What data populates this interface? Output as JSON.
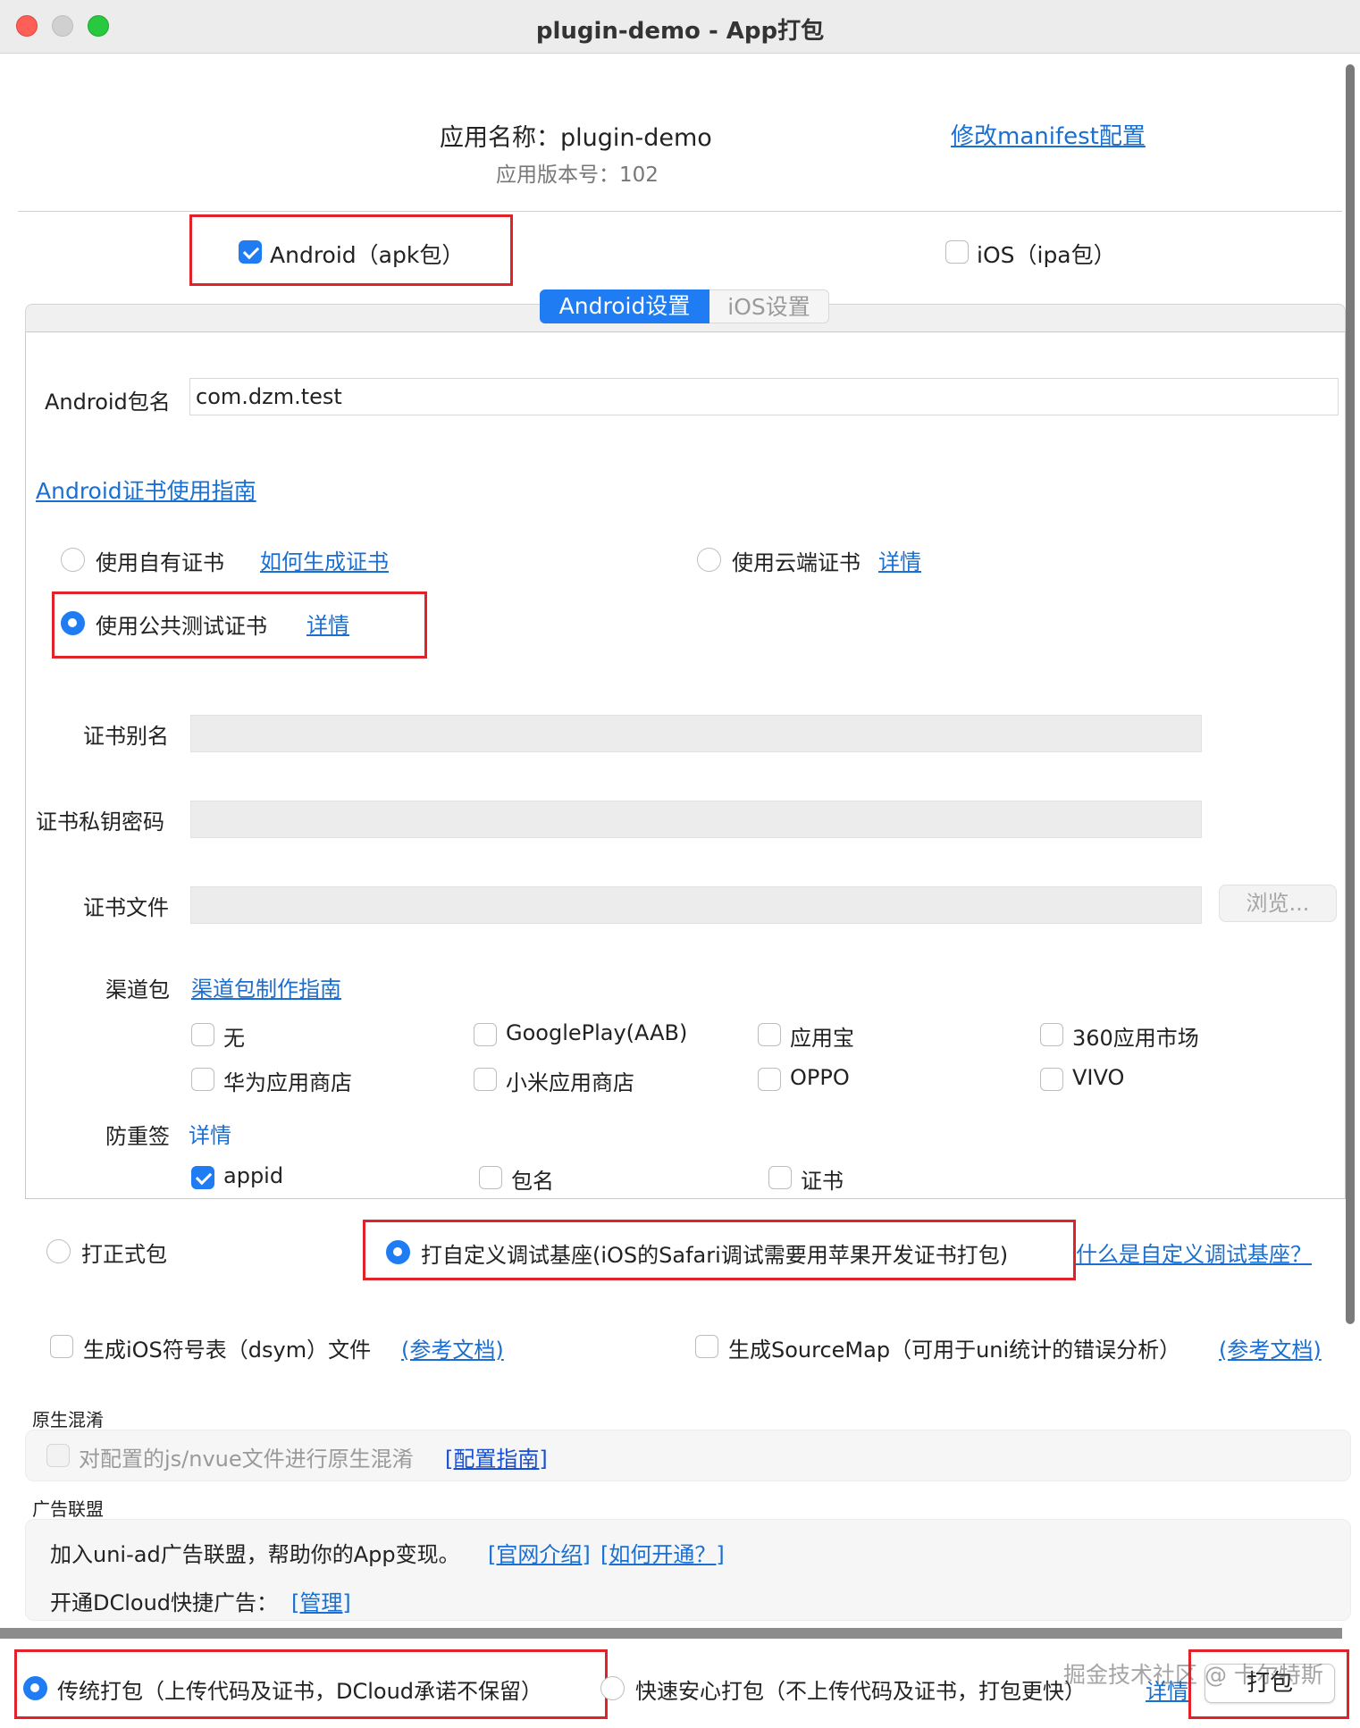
{
  "window": {
    "title": "plugin-demo - App打包"
  },
  "header": {
    "app_name": "应用名称：plugin-demo",
    "app_version": "应用版本号：102",
    "edit_manifest_link": "修改manifest配置"
  },
  "platforms": {
    "android_label": "Android（apk包）",
    "android_checked": true,
    "ios_label": "iOS（ipa包）",
    "ios_checked": false
  },
  "tabs": [
    {
      "label": "Android设置",
      "active": true
    },
    {
      "label": "iOS设置",
      "active": false
    }
  ],
  "android": {
    "package_name_label": "Android包名",
    "package_name_value": "com.dzm.test",
    "cert_guide_link": "Android证书使用指南",
    "cert_options": {
      "own_cert_label": "使用自有证书",
      "own_cert_link": "如何生成证书",
      "cloud_cert_label": "使用云端证书",
      "cloud_cert_link": "详情",
      "public_cert_label": "使用公共测试证书",
      "public_cert_link": "详情",
      "selected": "public"
    },
    "cert_alias_label": "证书别名",
    "cert_alias_value": "",
    "cert_password_label": "证书私钥密码",
    "cert_password_value": "",
    "cert_file_label": "证书文件",
    "cert_file_value": "",
    "browse_button": "浏览...",
    "channel_label": "渠道包",
    "channel_link": "渠道包制作指南",
    "channels": [
      {
        "label": "无",
        "checked": false
      },
      {
        "label": "GooglePlay(AAB)",
        "checked": false
      },
      {
        "label": "应用宝",
        "checked": false
      },
      {
        "label": "360应用市场",
        "checked": false
      },
      {
        "label": "华为应用商店",
        "checked": false
      },
      {
        "label": "小米应用商店",
        "checked": false
      },
      {
        "label": "OPPO",
        "checked": false
      },
      {
        "label": "VIVO",
        "checked": false
      }
    ],
    "anti_resign_label": "防重签",
    "anti_resign_link": "详情",
    "anti_resign_options": [
      {
        "label": "appid",
        "checked": true
      },
      {
        "label": "包名",
        "checked": false
      },
      {
        "label": "证书",
        "checked": false
      }
    ]
  },
  "build_type": {
    "release_label": "打正式包",
    "custom_base_label": "打自定义调试基座(iOS的Safari调试需要用苹果开发证书打包)",
    "custom_base_help_link": "什么是自定义调试基座？",
    "selected": "custom_base"
  },
  "extras": {
    "dsym_label": "生成iOS符号表（dsym）文件",
    "dsym_link": "(参考文档)",
    "sourcemap_label": "生成SourceMap（可用于uni统计的错误分析）",
    "sourcemap_link": "(参考文档)"
  },
  "obfuscation": {
    "section_title": "原生混淆",
    "option_label": "对配置的js/nvue文件进行原生混淆",
    "guide_link": "[配置指南]"
  },
  "ads": {
    "section_title": "广告联盟",
    "join_text": "加入uni-ad广告联盟，帮助你的App变现。",
    "intro_link": "[官网介绍]",
    "howto_link": "[如何开通？]",
    "quick_ad_text": "开通DCloud快捷广告：",
    "manage_link": "[管理]"
  },
  "footer": {
    "traditional_label": "传统打包（上传代码及证书，DCloud承诺不保留）",
    "safe_label": "快速安心打包（不上传代码及证书，打包更快）",
    "safe_link": "详情",
    "selected": "traditional",
    "pack_button": "打包",
    "watermark": "掘金技术社区 @ 卡尔特斯"
  },
  "colors": {
    "accent": "#1f7cf2",
    "link": "#1a6fd1",
    "highlight_box": "#e0222a"
  }
}
